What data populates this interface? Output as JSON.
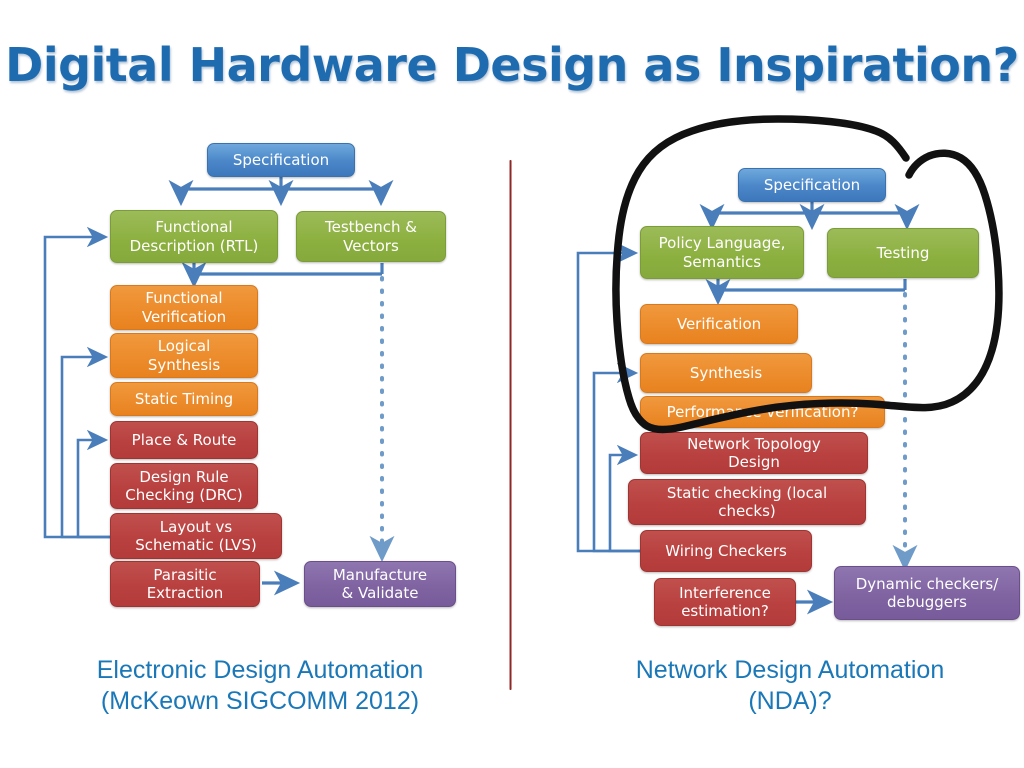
{
  "title": "Digital Hardware Design as Inspiration?",
  "colors": {
    "title_blue": "#1f6bb0",
    "spec_blue": "#4a86c8",
    "green": "#8cb03f",
    "orange": "#ec8c2c",
    "red": "#b8403f",
    "purple": "#8064a2",
    "divider_red": "#9e2f2b",
    "arrow_blue": "#4a7ebb",
    "annotation_black": "#000000",
    "caption_blue": "#1a78b8"
  },
  "left_diagram": {
    "caption_line1": "Electronic Design Automation",
    "caption_line2": "(McKeown SIGCOMM 2012)",
    "boxes": [
      {
        "id": "spec",
        "label": "Specification",
        "color": "blue"
      },
      {
        "id": "rtl",
        "label": "Functional\nDescription (RTL)",
        "color": "green"
      },
      {
        "id": "testbench",
        "label": "Testbench &\nVectors",
        "color": "green"
      },
      {
        "id": "funcver",
        "label": "Functional\nVerification",
        "color": "orange"
      },
      {
        "id": "logsynth",
        "label": "Logical\nSynthesis",
        "color": "orange"
      },
      {
        "id": "statictiming",
        "label": "Static Timing",
        "color": "orange"
      },
      {
        "id": "placeroute",
        "label": "Place & Route",
        "color": "red"
      },
      {
        "id": "drc",
        "label": "Design Rule\nChecking (DRC)",
        "color": "red"
      },
      {
        "id": "lvs",
        "label": "Layout vs\nSchematic (LVS)",
        "color": "red"
      },
      {
        "id": "parasitic",
        "label": "Parasitic\nExtraction",
        "color": "red"
      },
      {
        "id": "manufacture",
        "label": "Manufacture\n& Validate",
        "color": "purple"
      }
    ]
  },
  "right_diagram": {
    "caption_line1": "Network Design Automation",
    "caption_line2": "(NDA)?",
    "annotation": "hand-drawn-circle",
    "boxes": [
      {
        "id": "spec2",
        "label": "Specification",
        "color": "blue"
      },
      {
        "id": "policy",
        "label": "Policy Language,\nSemantics",
        "color": "green"
      },
      {
        "id": "testing",
        "label": "Testing",
        "color": "green"
      },
      {
        "id": "verification",
        "label": "Verification",
        "color": "orange"
      },
      {
        "id": "synthesis",
        "label": "Synthesis",
        "color": "orange"
      },
      {
        "id": "perfver",
        "label": "Performance verification?",
        "color": "orange"
      },
      {
        "id": "topology",
        "label": "Network Topology\nDesign",
        "color": "red"
      },
      {
        "id": "staticcheck",
        "label": "Static checking (local\nchecks)",
        "color": "red"
      },
      {
        "id": "wiring",
        "label": "Wiring Checkers",
        "color": "red"
      },
      {
        "id": "interference",
        "label": "Interference\nestimation?",
        "color": "red"
      },
      {
        "id": "dynamic",
        "label": "Dynamic checkers/\ndebuggers",
        "color": "purple"
      }
    ]
  }
}
